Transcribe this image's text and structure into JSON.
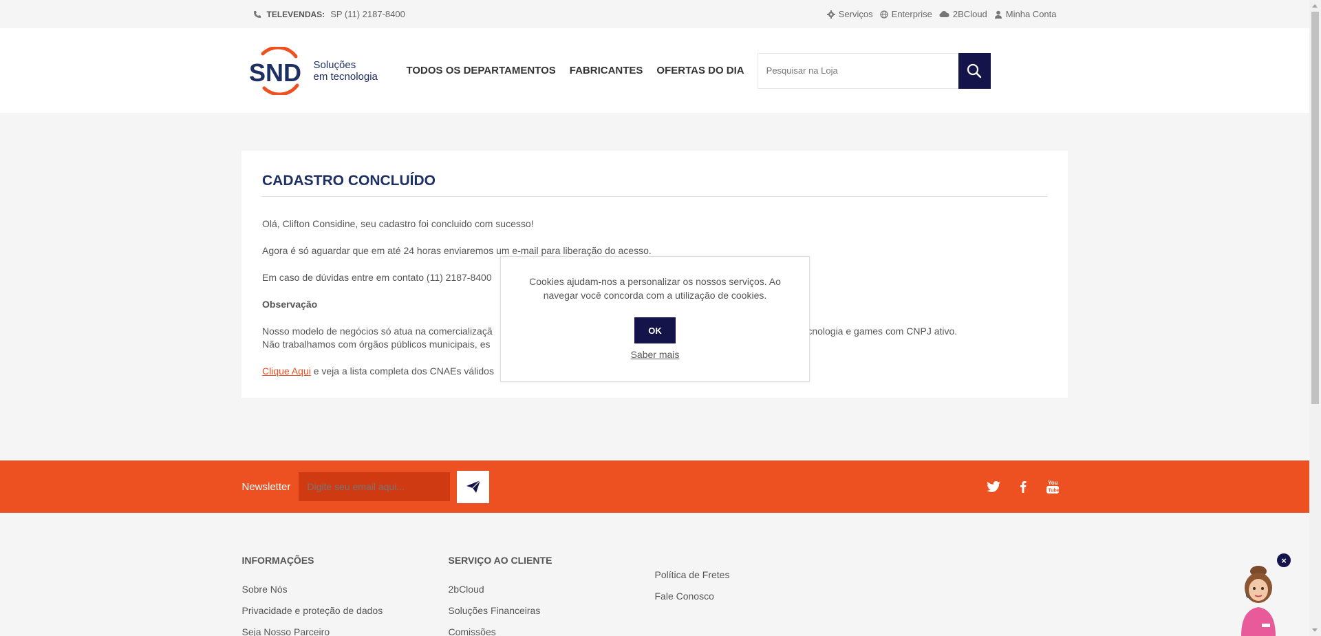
{
  "topbar": {
    "phone_label": "TELEVENDAS:",
    "phone_value": "SP (11)  2187-8400",
    "links": [
      "Serviços",
      "Enterprise",
      "2BCloud",
      "Minha Conta"
    ]
  },
  "header": {
    "logo_text": "SND",
    "logo_tag_1": "Soluções",
    "logo_tag_2": "em tecnologia",
    "nav": [
      "TODOS OS DEPARTAMENTOS",
      "FABRICANTES",
      "OFERTAS DO DIA"
    ],
    "search_placeholder": "Pesquisar na Loja"
  },
  "main": {
    "title": "CADASTRO CONCLUÍDO",
    "p1": "Olá, Clifton Considine, seu cadastro foi concluido com sucesso!",
    "p2": "Agora é só aguardar que em até 24 horas enviaremos um e-mail para liberação do acesso.",
    "p3": "Em caso de dúvidas entre em contato (11) 2187-8400",
    "obs_title": "Observação",
    "p4a": "Nosso modelo de negócios só atua na comercializaçã",
    "p4b": "tecnologia e games com CNPJ ativo.",
    "p5": "Não trabalhamos com órgãos públicos municipais, es",
    "link_text": "Clique Aqui",
    "p6": " e veja a lista completa dos CNAEs válidos"
  },
  "cookie": {
    "message": "Cookies ajudam-nos a personalizar os nossos serviços. Ao navegar você concorda com a utilização de cookies.",
    "ok": "OK",
    "more": "Saber mais"
  },
  "newsletter": {
    "label": "Newsletter",
    "placeholder": "Digite seu email aqui..."
  },
  "footer": {
    "col1_title": "INFORMAÇÕES",
    "col1_items": [
      "Sobre Nós",
      "Privacidade e proteção de dados",
      "Seja Nosso Parceiro"
    ],
    "col2_title": "SERVIÇO AO CLIENTE",
    "col2_items": [
      "2bCloud",
      "Soluções Financeiras",
      "Comissões"
    ],
    "col3_items": [
      "Política de Fretes",
      "Fale Conosco"
    ]
  },
  "chat": {
    "close": "×"
  },
  "colors": {
    "navy": "#14144a",
    "orange": "#ee5121",
    "logo_blue": "#1e2f63"
  }
}
